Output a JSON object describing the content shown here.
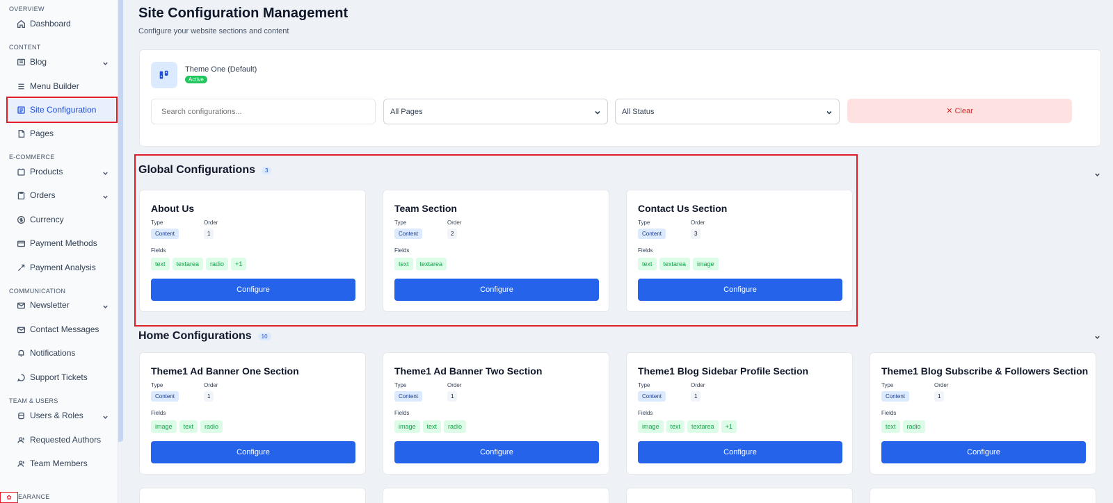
{
  "sidebar": {
    "groups": {
      "overview": "OVERVIEW",
      "content": "CONTENT",
      "ecommerce": "E-COMMERCE",
      "communication": "COMMUNICATION",
      "team": "TEAM & USERS",
      "appearance": "EARANCE"
    },
    "items": {
      "dashboard": "Dashboard",
      "blog": "Blog",
      "menu_builder": "Menu Builder",
      "site_configuration": "Site Configuration",
      "pages": "Pages",
      "products": "Products",
      "orders": "Orders",
      "currency": "Currency",
      "payment_methods": "Payment Methods",
      "payment_analysis": "Payment Analysis",
      "newsletter": "Newsletter",
      "contact_messages": "Contact Messages",
      "notifications": "Notifications",
      "support_tickets": "Support Tickets",
      "users_roles": "Users & Roles",
      "requested_authors": "Requested Authors",
      "team_members": "Team Members"
    }
  },
  "header": {
    "title": "Site Configuration Management",
    "subtitle": "Configure your website sections and content"
  },
  "theme": {
    "name": "Theme One (Default)",
    "status": "Active"
  },
  "filters": {
    "search_placeholder": "Search configurations...",
    "pages_value": "All Pages",
    "status_value": "All Status",
    "clear_label": "✕ Clear"
  },
  "labels": {
    "type": "Type",
    "order": "Order",
    "fields": "Fields",
    "configure": "Configure"
  },
  "global": {
    "title": "Global Configurations",
    "count": "3",
    "cards": [
      {
        "title": "About Us",
        "type": "Content",
        "order": "1",
        "fields": [
          "text",
          "textarea",
          "radio",
          "+1"
        ]
      },
      {
        "title": "Team Section",
        "type": "Content",
        "order": "2",
        "fields": [
          "text",
          "textarea"
        ]
      },
      {
        "title": "Contact Us Section",
        "type": "Content",
        "order": "3",
        "fields": [
          "text",
          "textarea",
          "image"
        ]
      }
    ]
  },
  "home": {
    "title": "Home Configurations",
    "count": "10",
    "cards": [
      {
        "title": "Theme1 Ad Banner One Section",
        "type": "Content",
        "order": "1",
        "fields": [
          "image",
          "text",
          "radio"
        ]
      },
      {
        "title": "Theme1 Ad Banner Two Section",
        "type": "Content",
        "order": "1",
        "fields": [
          "image",
          "text",
          "radio"
        ]
      },
      {
        "title": "Theme1 Blog Sidebar Profile Section",
        "type": "Content",
        "order": "1",
        "fields": [
          "image",
          "text",
          "textarea",
          "+1"
        ]
      },
      {
        "title": "Theme1 Blog Subscribe & Followers Section",
        "type": "Content",
        "order": "1",
        "fields": [
          "text",
          "radio"
        ]
      }
    ]
  },
  "icons": {
    "corner_logo": "red-logo-icon"
  }
}
